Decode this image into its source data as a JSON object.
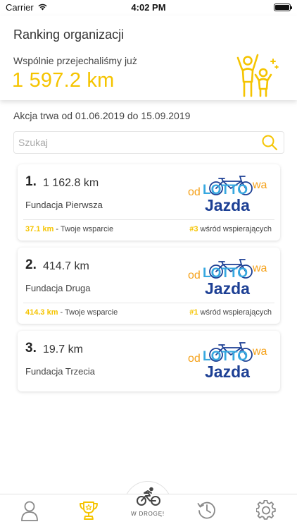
{
  "status_bar": {
    "carrier": "Carrier",
    "time": "4:02 PM"
  },
  "header": {
    "title": "Ranking organizacji",
    "total_caption": "Wspólnie przejechaliśmy już",
    "total_value": "1 597.2 km"
  },
  "period": "Akcja trwa od 01.06.2019 do 15.09.2019",
  "search": {
    "placeholder": "Szukaj",
    "value": ""
  },
  "logo_text": {
    "line1": "odLOTTOwa",
    "line2": "Jazda"
  },
  "ranking": [
    {
      "rank": "1.",
      "km": "1 162.8 km",
      "name": "Fundacja Pierwsza",
      "support_km": "37.1 km",
      "support_label": " - Twoje wsparcie",
      "support_rank": "#3",
      "support_rank_label": " wśród wspierających"
    },
    {
      "rank": "2.",
      "km": "414.7 km",
      "name": "Fundacja Druga",
      "support_km": "414.3 km",
      "support_label": " - Twoje wsparcie",
      "support_rank": "#1",
      "support_rank_label": " wśród wspierających"
    },
    {
      "rank": "3.",
      "km": "19.7 km",
      "name": "Fundacja Trzecia"
    }
  ],
  "tab_bar": {
    "fab_label": "W DROGĘ!",
    "icons": [
      "profile-icon",
      "trophy-icon",
      "bike-icon",
      "history-icon",
      "settings-icon"
    ],
    "active": "trophy-icon"
  },
  "colors": {
    "accent": "#f5c400",
    "logo_blue": "#1c3f94",
    "logo_sky": "#36a8e0",
    "logo_orange": "#f5a21b"
  }
}
